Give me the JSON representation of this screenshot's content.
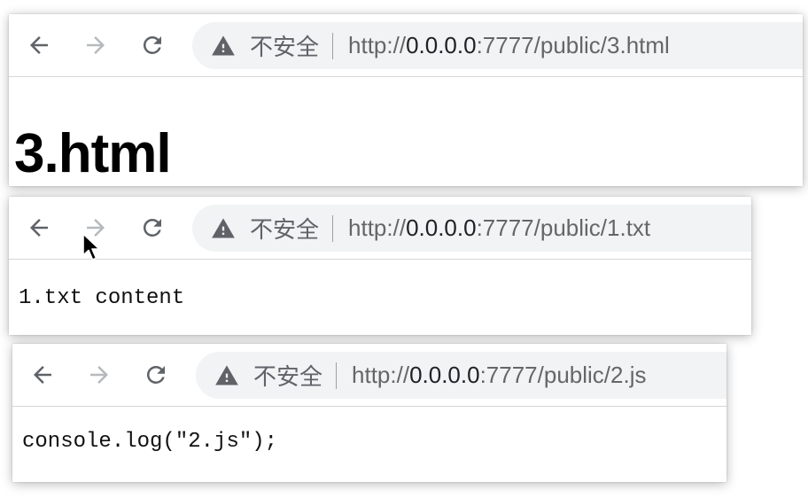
{
  "colors": {
    "icon_active": "#5f6368",
    "icon_disabled": "#b6b9bd",
    "omnibox_bg": "#f1f3f4",
    "text": "#202124"
  },
  "windows": [
    {
      "security_label": "不安全",
      "url_scheme": "http://",
      "url_host": "0.0.0.0",
      "url_path": ":7777/public/3.html",
      "content": "3.html",
      "content_type": "heading"
    },
    {
      "security_label": "不安全",
      "url_scheme": "http://",
      "url_host": "0.0.0.0",
      "url_path": ":7777/public/1.txt",
      "content": "1.txt content",
      "content_type": "plain-text"
    },
    {
      "security_label": "不安全",
      "url_scheme": "http://",
      "url_host": "0.0.0.0",
      "url_path": ":7777/public/2.js",
      "content": "console.log(\"2.js\");",
      "content_type": "plain-text"
    }
  ],
  "icons": {
    "back": "arrow-left-icon",
    "forward": "arrow-right-icon",
    "reload": "reload-icon",
    "security": "warning-triangle-icon",
    "pointer": "mouse-pointer-icon"
  }
}
